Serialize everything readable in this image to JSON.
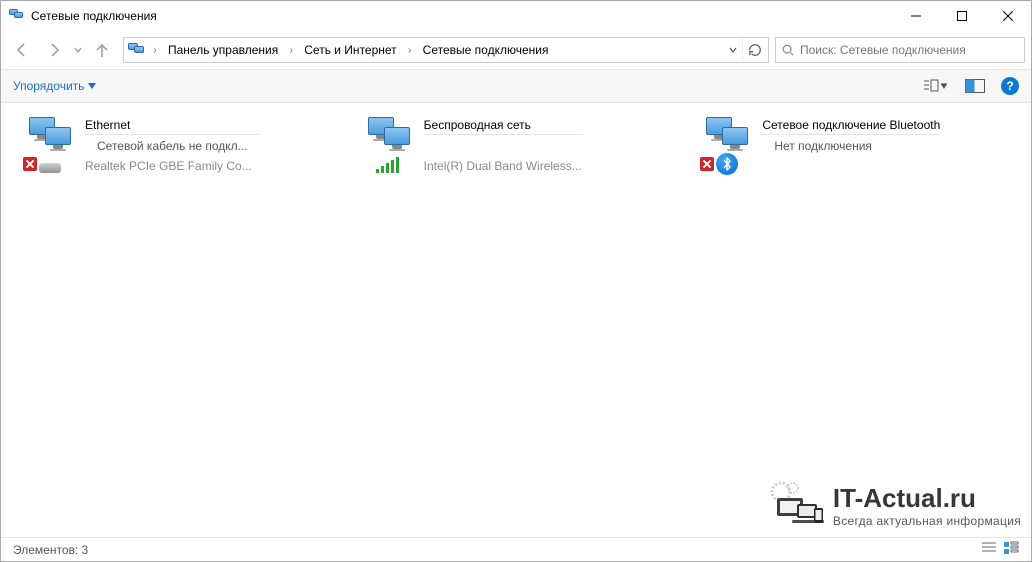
{
  "window": {
    "title": "Сетевые подключения"
  },
  "breadcrumb": {
    "seg1": "Панель управления",
    "seg2": "Сеть и Интернет",
    "seg3": "Сетевые подключения"
  },
  "search": {
    "placeholder": "Поиск: Сетевые подключения"
  },
  "toolbar": {
    "organize": "Упорядочить"
  },
  "connections": [
    {
      "name": "Ethernet",
      "status": "Сетевой кабель не подкл...",
      "device": "Realtek PCIe GBE Family Co..."
    },
    {
      "name": "Беспроводная сеть",
      "status": "",
      "device": "Intel(R) Dual Band Wireless..."
    },
    {
      "name": "Сетевое подключение Bluetooth",
      "status": "Нет подключения",
      "device": ""
    }
  ],
  "statusbar": {
    "label": "Элементов:",
    "count": "3"
  },
  "watermark": {
    "line1": "IT-Actual.ru",
    "line2": "Всегда актуальная информация"
  }
}
